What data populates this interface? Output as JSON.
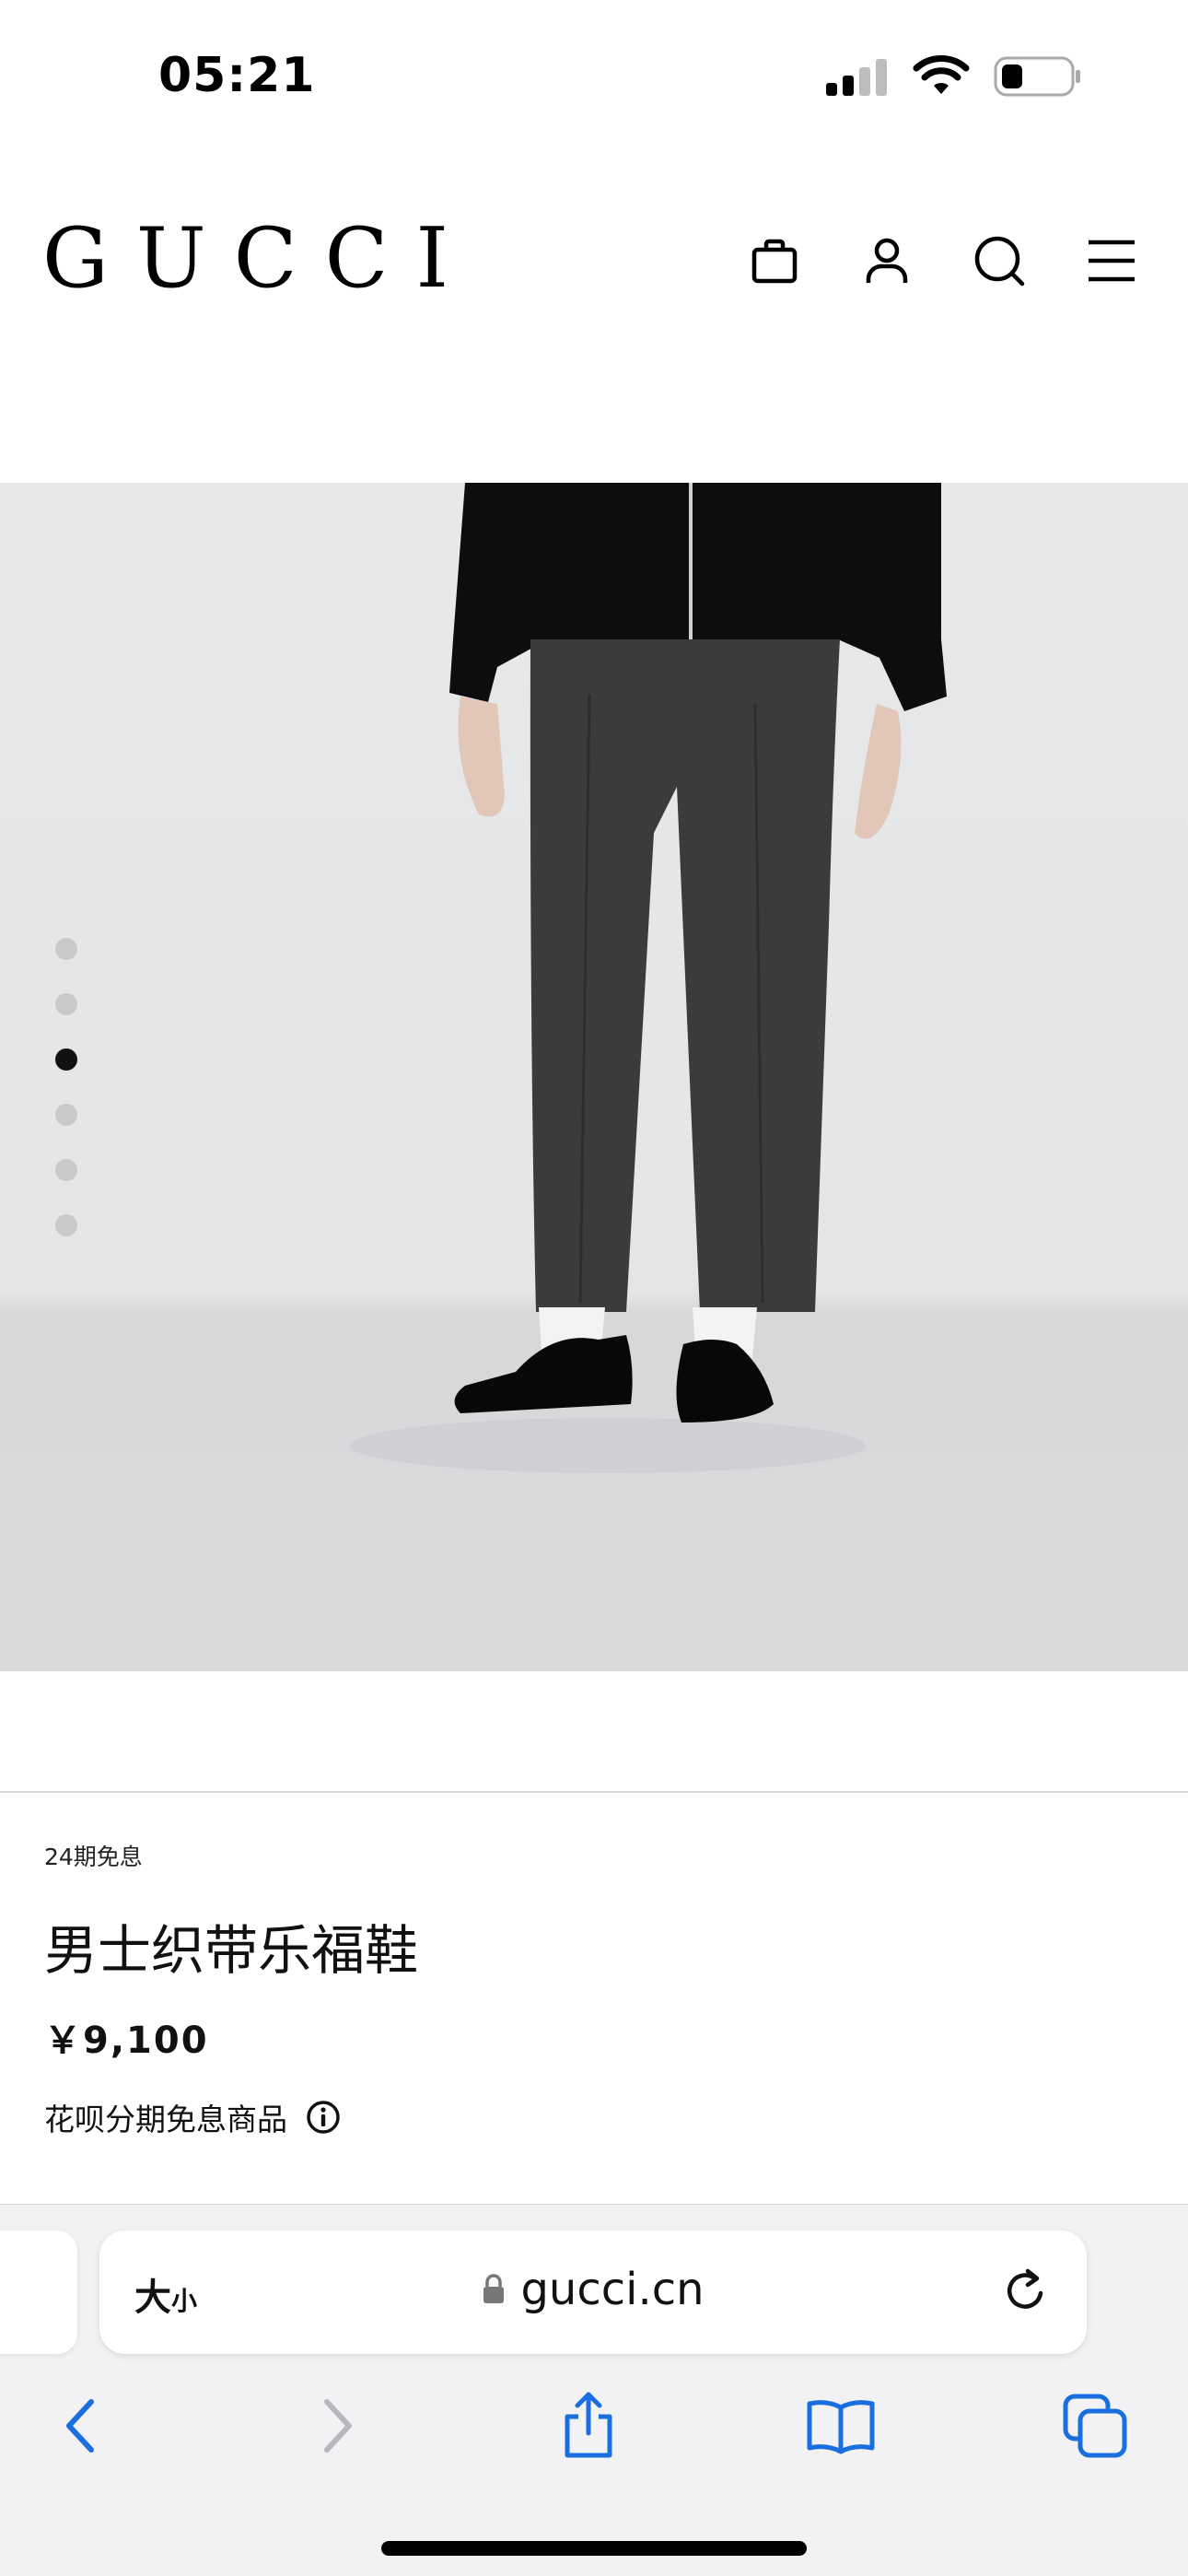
{
  "status_bar": {
    "time": "05:21"
  },
  "header": {
    "brand": "GUCCI",
    "icons": [
      "shopping-bag-icon",
      "account-icon",
      "search-icon",
      "menu-icon"
    ]
  },
  "carousel": {
    "total": 6,
    "active_index": 2
  },
  "product": {
    "badge": "24期免息",
    "title": "男士织带乐福鞋",
    "price": "￥9,100",
    "installment_text": "花呗分期免息商品"
  },
  "browser": {
    "text_size_big": "大",
    "text_size_small": "小",
    "url": "gucci.cn"
  },
  "colors": {
    "accent": "#1a6fe0",
    "disabled": "#b8b8bc"
  }
}
